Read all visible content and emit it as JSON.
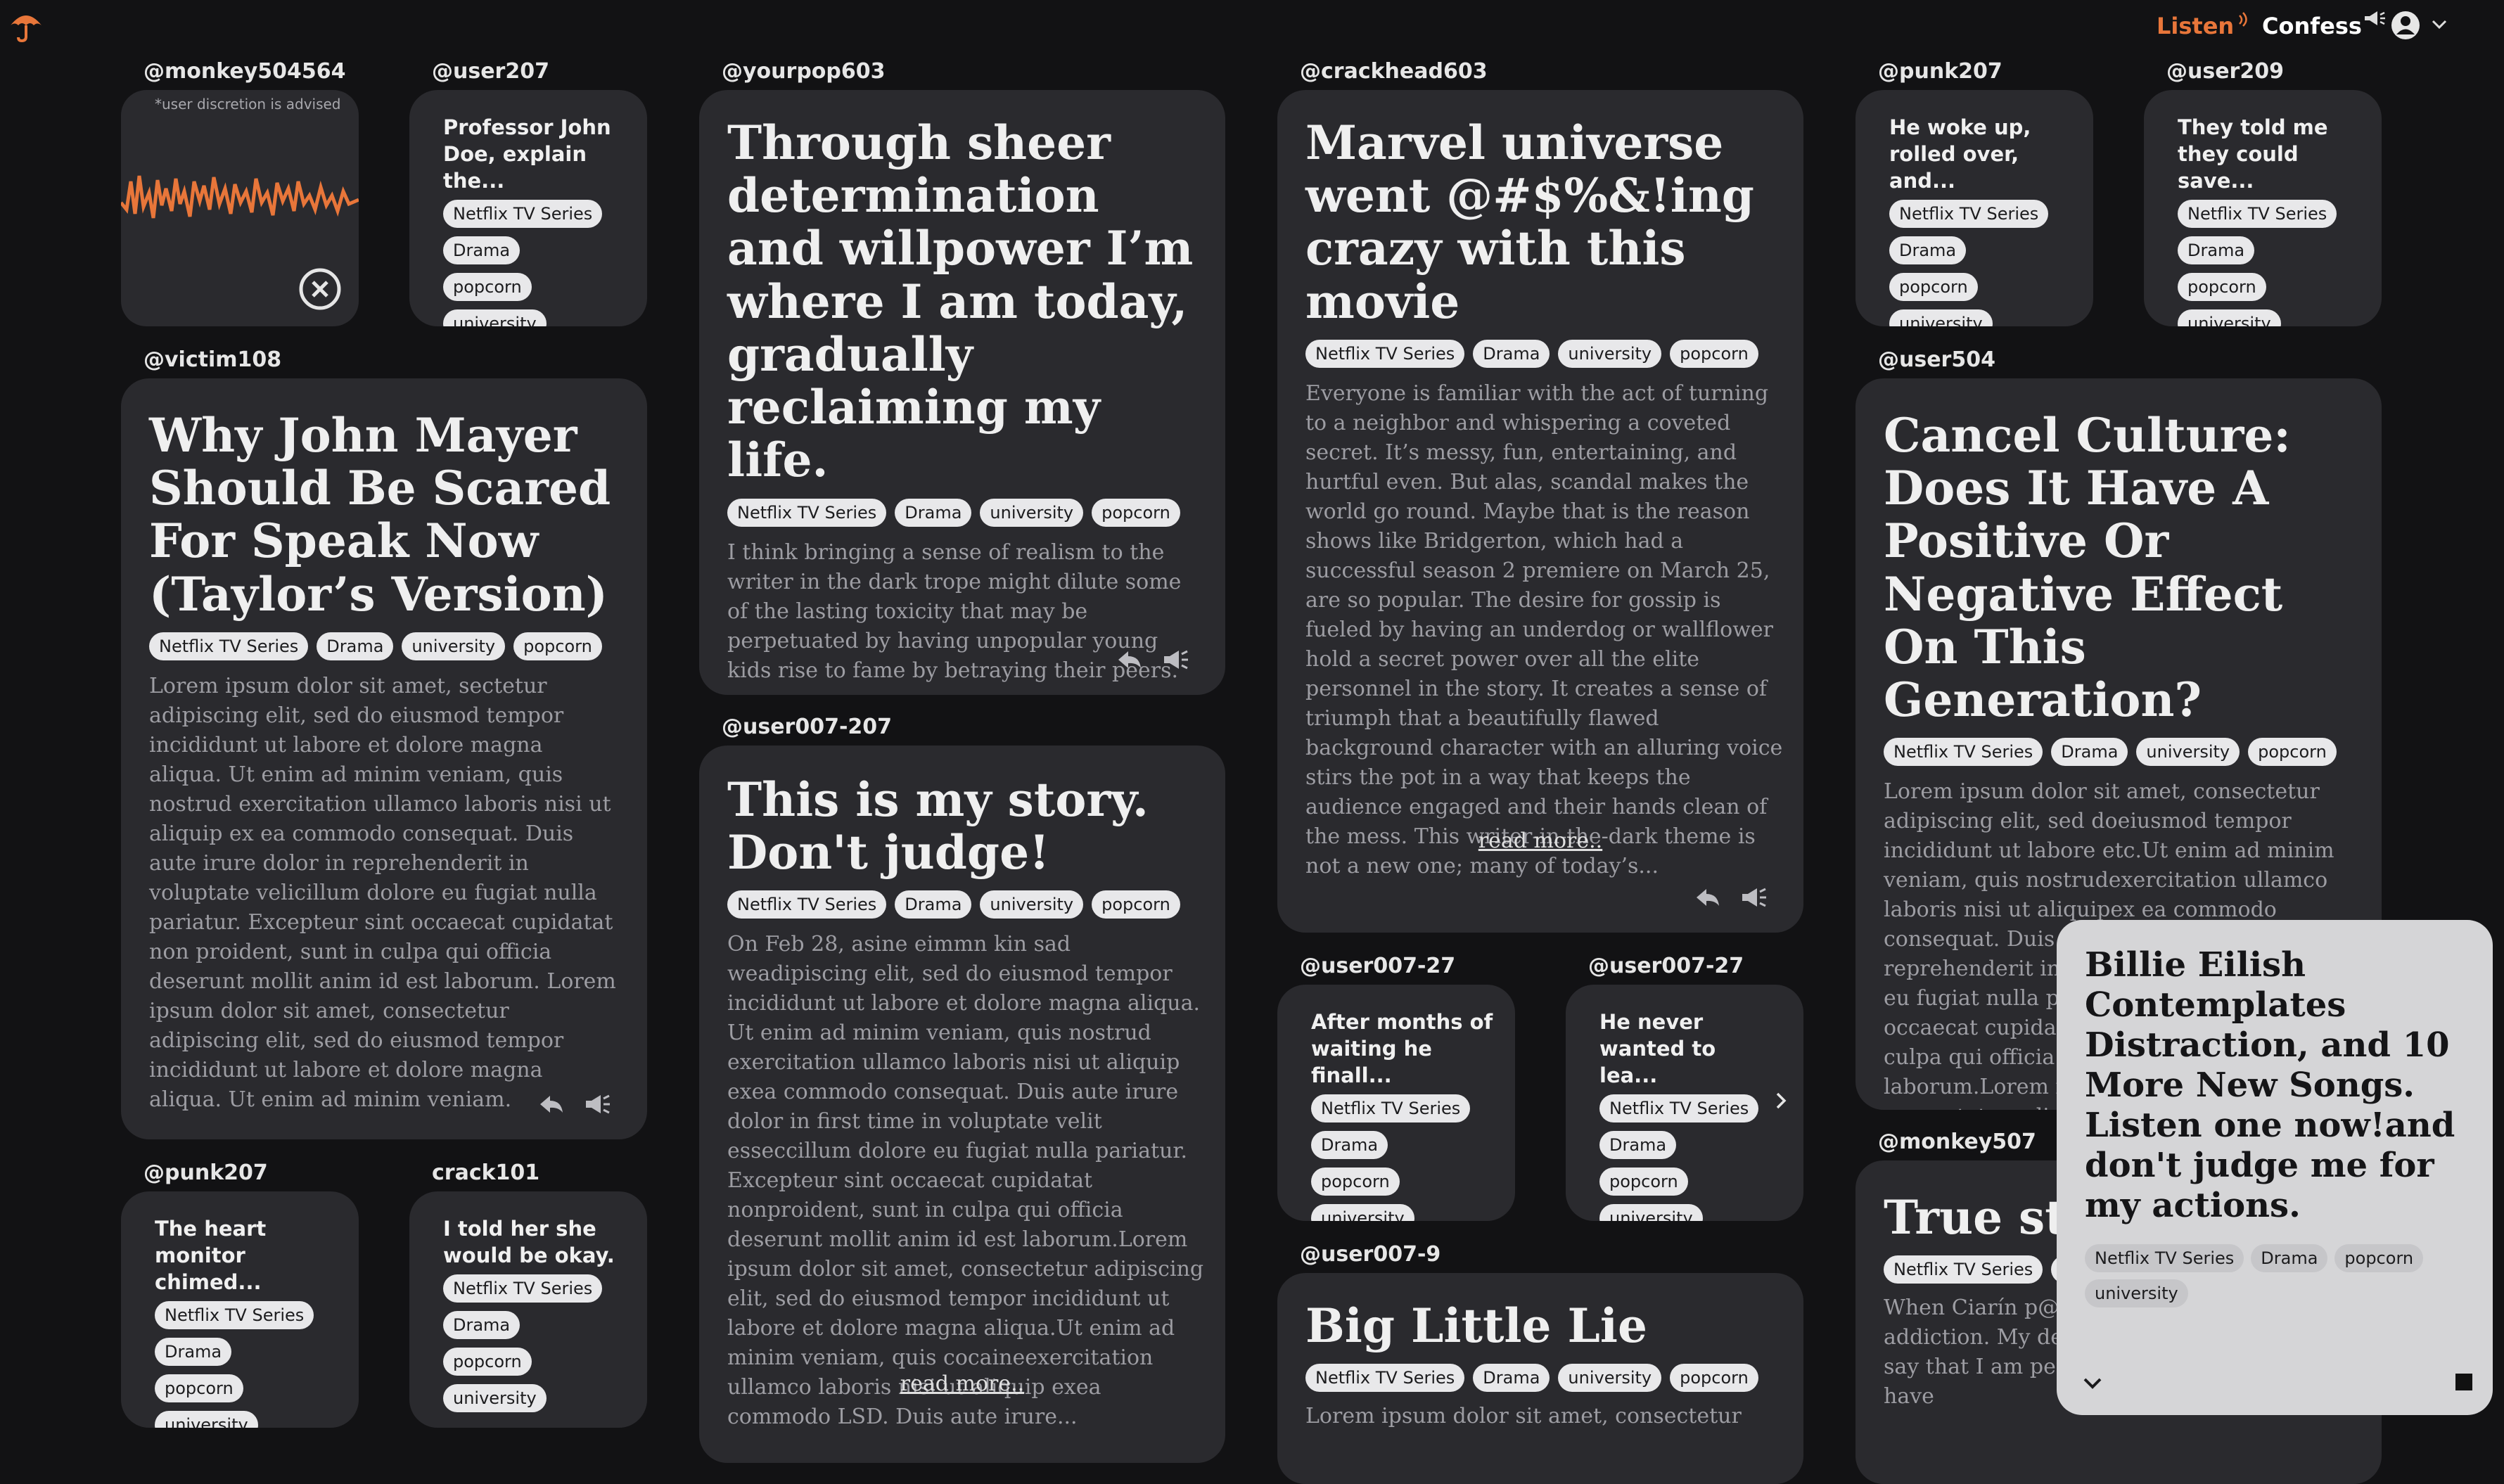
{
  "header": {
    "listen_label": "Listen",
    "confess_label": "Confess",
    "accent_color": "#e8763a"
  },
  "waveform_card": {
    "handle": "@monkey504564",
    "disclaimer": "*user discretion is advised",
    "icons": [
      "waveform",
      "close-icon"
    ]
  },
  "common_tags": [
    "Netflix TV Series",
    "Drama",
    "university",
    "popcorn"
  ],
  "small_tags": [
    "Netflix TV Series",
    "Drama",
    "popcorn",
    "university"
  ],
  "cards": {
    "user207": {
      "handle": "@user207",
      "title": "Professor John Doe, explain the..."
    },
    "yourpop603": {
      "handle": "@yourpop603",
      "title": "Through sheer determination and willpower I’m where I am today, gradually reclaiming my life.",
      "body": "I think bringing a sense of realism to the writer in the dark trope might dilute some of the lasting toxicity that may be perpetuated by having unpopular young kids rise to fame by betraying their peers."
    },
    "crackhead603": {
      "handle": "@crackhead603",
      "title": "Marvel universe went @#$%&!ing crazy with this movie",
      "body": "Everyone is familiar with the act of turning to a neighbor and whispering a coveted secret. It’s messy, fun, entertaining, and hurtful even. But alas, scandal makes the world go round. Maybe that is the reason shows like Bridgerton, which had a successful season 2 premiere on March 25, are so popular. The desire for gossip is fueled by having an underdog or wallflower hold a secret power over all the elite personnel in the story. It creates a sense of triumph that a beautifully flawed background character with an alluring voice stirs the pot in a way that keeps the audience engaged and their hands clean of the mess. This writer-in-the-dark theme is not a new one; many of today’s...",
      "readmore": "read more.."
    },
    "punk207_top": {
      "handle": "@punk207",
      "title": "He woke up, rolled over, and..."
    },
    "user209": {
      "handle": "@user209",
      "title": "They told me they could save..."
    },
    "victim108": {
      "handle": "@victim108",
      "title": "Why John Mayer Should Be Scared For Speak Now (Taylor’s Version)",
      "body": "Lorem ipsum dolor sit amet, sectetur adipiscing elit, sed do eiusmod tempor incididunt ut labore et dolore magna aliqua. Ut enim ad minim veniam, quis nostrud exercitation ullamco laboris nisi ut aliquip ex ea commodo consequat. Duis aute irure dolor in reprehenderit in voluptate velicillum dolore eu fugiat nulla pariatur. Excepteur sint occaecat cupidatat non proident, sunt in culpa qui officia deserunt mollit anim id est laborum. Lorem ipsum dolor sit amet, consectetur adipiscing elit, sed do eiusmod tempor incididunt ut labore et dolore magna aliqua. Ut enim ad minim veniam."
    },
    "user007_207": {
      "handle": "@user007-207",
      "title": "This is my story. Don't judge!",
      "body": "On Feb 28, asine eimmn kin sad weadipiscing elit, sed do eiusmod tempor incididunt ut labore et dolore magna aliqua. Ut enim ad minim veniam, quis nostrud exercitation ullamco laboris nisi ut aliquip exea commodo consequat. Duis aute irure dolor in first time in voluptate velit esseccillum dolore eu fugiat nulla pariatur. Excepteur sint occaecat cupidatat nonproident, sunt in culpa qui officia deserunt mollit anim id est laborum.Lorem ipsum dolor sit amet, consectetur adipiscing elit, sed do eiusmod tempor incididunt ut labore et dolore magna aliqua.Ut enim ad minim veniam, quis cocaineexercitation ullamco laboris nisi ut aliquip exea commodo LSD. Duis aute irure...",
      "readmore": "read more.."
    },
    "user007_27a": {
      "handle": "@user007-27",
      "title": "After months of waiting he finall..."
    },
    "user007_27b": {
      "handle": "@user007-27",
      "title": "He never wanted to lea..."
    },
    "user504": {
      "handle": "@user504",
      "title": "Cancel Culture: Does It Have A Positive Or Negative Effect On This Generation?",
      "body": "Lorem ipsum dolor sit amet, consectetur adipiscing elit, sed doeiusmod tempor incididunt ut labore etc.Ut enim ad minim veniam, quis nostrudexercitation ullamco laboris nisi ut aliquipex ea commodo consequat. Duis aute iruredolor in reprehenderit in voluptate iscillum dolore eu fugiat nulla pariatur.Excepteur sint occaecat cupidatat nonproident, sunt in culpa qui officia deseruntmollit anim id est laborum.Lorem ipsum dolor sit amet, consectetur adipiscing elit, sed do eiusmod tempor incididunt ut labore et dolore magna aliqua."
    },
    "user007_9": {
      "handle": "@user007-9",
      "title": "Big Little Lie",
      "body": "Lorem ipsum dolor sit amet, consectetur"
    },
    "punk207_bottom": {
      "handle": "@punk207",
      "title": "The heart monitor chimed..."
    },
    "crack101": {
      "handle": "crack101",
      "title": "I told her she would be okay."
    },
    "monkey507": {
      "handle": "@monkey507",
      "title": "True sto",
      "body": "When Ciarín p@#... deciding point in... addiction. My de... better, I got help... to say that I am perfect. I do absolutely have"
    }
  },
  "player": {
    "title": "Billie Eilish Contemplates Distraction, and 10 More New Songs. Listen one now!and don't judge me for my actions.",
    "tags": [
      "Netflix TV Series",
      "Drama",
      "popcorn",
      "university"
    ]
  }
}
